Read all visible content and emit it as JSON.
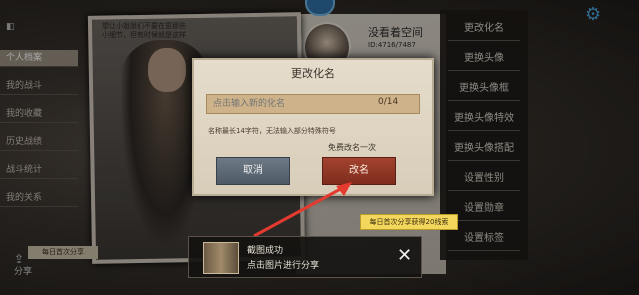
{
  "sidebar": {
    "items": [
      {
        "label": "个人档案"
      },
      {
        "label": "我的战斗"
      },
      {
        "label": "我的收藏"
      },
      {
        "label": "历史战绩"
      },
      {
        "label": "战斗统计"
      },
      {
        "label": "我的关系"
      }
    ],
    "share_label": "分享",
    "daily_share": "每日首次分享"
  },
  "profile": {
    "name": "没看着空间",
    "id": "ID:4716/7487"
  },
  "card_note": "想让小姐姐们不要在意那些小细节，但有时候就是这样",
  "right_menu": {
    "items": [
      {
        "label": "更改化名"
      },
      {
        "label": "更换头像"
      },
      {
        "label": "更换头像框"
      },
      {
        "label": "更换头像特效"
      },
      {
        "label": "更换头像搭配"
      },
      {
        "label": "设置性别"
      },
      {
        "label": "设置勋章"
      },
      {
        "label": "设置标签"
      }
    ]
  },
  "dialog": {
    "title": "更改化名",
    "placeholder": "点击输入新的化名",
    "char_count": "0/14",
    "hint": "名称最长14字符，无法输入部分特殊符号",
    "free_note": "免费改名一次",
    "cancel_label": "取消",
    "rename_label": "改名"
  },
  "share_tip": "每日首次分享获得20线索",
  "toast": {
    "title": "截图成功",
    "subtitle": "点击图片进行分享"
  },
  "colors": {
    "accent_red": "#a3432f",
    "accent_blue": "#4aa0d8",
    "arrow": "#e53a2f"
  }
}
